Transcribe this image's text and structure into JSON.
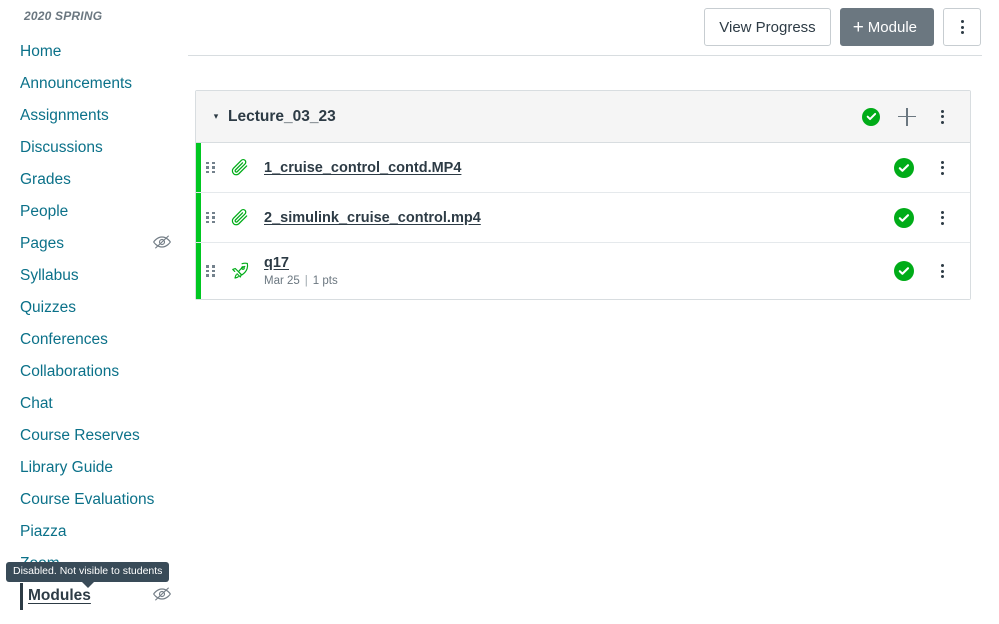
{
  "sidebar": {
    "term_label": "2020 SPRING",
    "items": [
      {
        "label": "Home",
        "active": false,
        "hidden_icon": false
      },
      {
        "label": "Announcements",
        "active": false,
        "hidden_icon": false
      },
      {
        "label": "Assignments",
        "active": false,
        "hidden_icon": false
      },
      {
        "label": "Discussions",
        "active": false,
        "hidden_icon": false
      },
      {
        "label": "Grades",
        "active": false,
        "hidden_icon": false
      },
      {
        "label": "People",
        "active": false,
        "hidden_icon": false
      },
      {
        "label": "Pages",
        "active": false,
        "hidden_icon": true
      },
      {
        "label": "Syllabus",
        "active": false,
        "hidden_icon": false
      },
      {
        "label": "Quizzes",
        "active": false,
        "hidden_icon": false
      },
      {
        "label": "Conferences",
        "active": false,
        "hidden_icon": false
      },
      {
        "label": "Collaborations",
        "active": false,
        "hidden_icon": false
      },
      {
        "label": "Chat",
        "active": false,
        "hidden_icon": false
      },
      {
        "label": "Course Reserves",
        "active": false,
        "hidden_icon": false
      },
      {
        "label": "Library Guide",
        "active": false,
        "hidden_icon": false
      },
      {
        "label": "Course Evaluations",
        "active": false,
        "hidden_icon": false
      },
      {
        "label": "Piazza",
        "active": false,
        "hidden_icon": false
      },
      {
        "label": "Zoom",
        "active": false,
        "hidden_icon": false
      },
      {
        "label": "Modules",
        "active": true,
        "hidden_icon": true
      }
    ],
    "tooltip": "Disabled. Not visible to students"
  },
  "toolbar": {
    "view_progress_label": "View Progress",
    "add_module_label": "Module",
    "add_module_plus": "+",
    "kebab_name": "more-options"
  },
  "module": {
    "title": "Lecture_03_23",
    "collapse_arrow": "▾",
    "items": [
      {
        "title": "1_cruise_control_contd.MP4",
        "icon": "paperclip-icon",
        "meta_date": "",
        "meta_points": "",
        "completed": true
      },
      {
        "title": "2_simulink_cruise_control.mp4",
        "icon": "paperclip-icon",
        "meta_date": "",
        "meta_points": "",
        "completed": true
      },
      {
        "title": "q17",
        "icon": "rocket-icon",
        "meta_date": "Mar 25",
        "meta_separator": "|",
        "meta_points": "1 pts",
        "completed": true
      }
    ]
  },
  "colors": {
    "link": "#0b7189",
    "text": "#2d3b45",
    "muted": "#6b7780",
    "green": "#00ac18",
    "green_bar": "#00c721",
    "border": "#d8dde0",
    "header_bg": "#f5f5f5",
    "primary_btn": "#6b7780",
    "tooltip_bg": "#394B58"
  }
}
